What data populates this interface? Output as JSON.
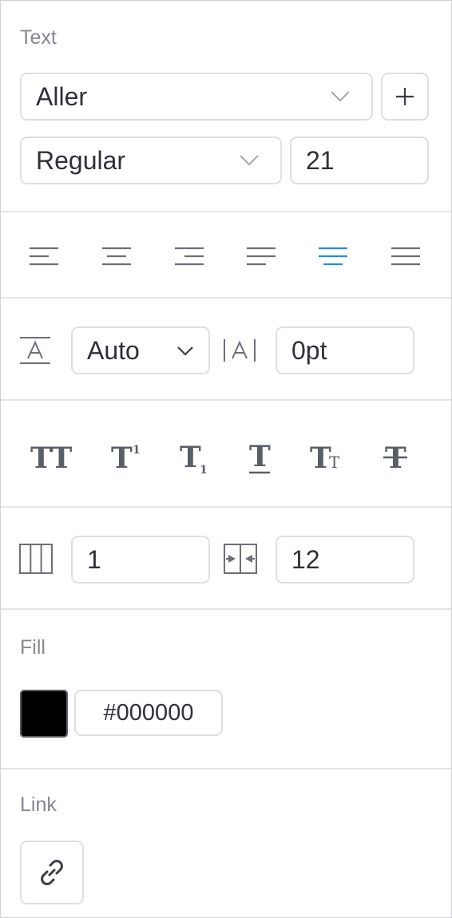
{
  "text_section": {
    "heading": "Text",
    "font_family": "Aller",
    "font_style": "Regular",
    "font_size": "21"
  },
  "alignment": {
    "options": [
      "align-left",
      "align-center",
      "align-right",
      "justify-left",
      "justify-center",
      "justify-all"
    ],
    "selected": "justify-center",
    "active_color": "#1e8df0",
    "icon_color": "#6b6f78"
  },
  "spacing": {
    "line_height": "Auto",
    "letter_spacing": "0pt"
  },
  "text_styles": {
    "buttons": [
      "uppercase",
      "superscript",
      "subscript",
      "underline",
      "small-caps",
      "strikethrough"
    ]
  },
  "columns": {
    "count": "1",
    "gutter": "12"
  },
  "fill": {
    "heading": "Fill",
    "swatch_color": "#000000",
    "hex_value": "#000000"
  },
  "link": {
    "heading": "Link"
  }
}
